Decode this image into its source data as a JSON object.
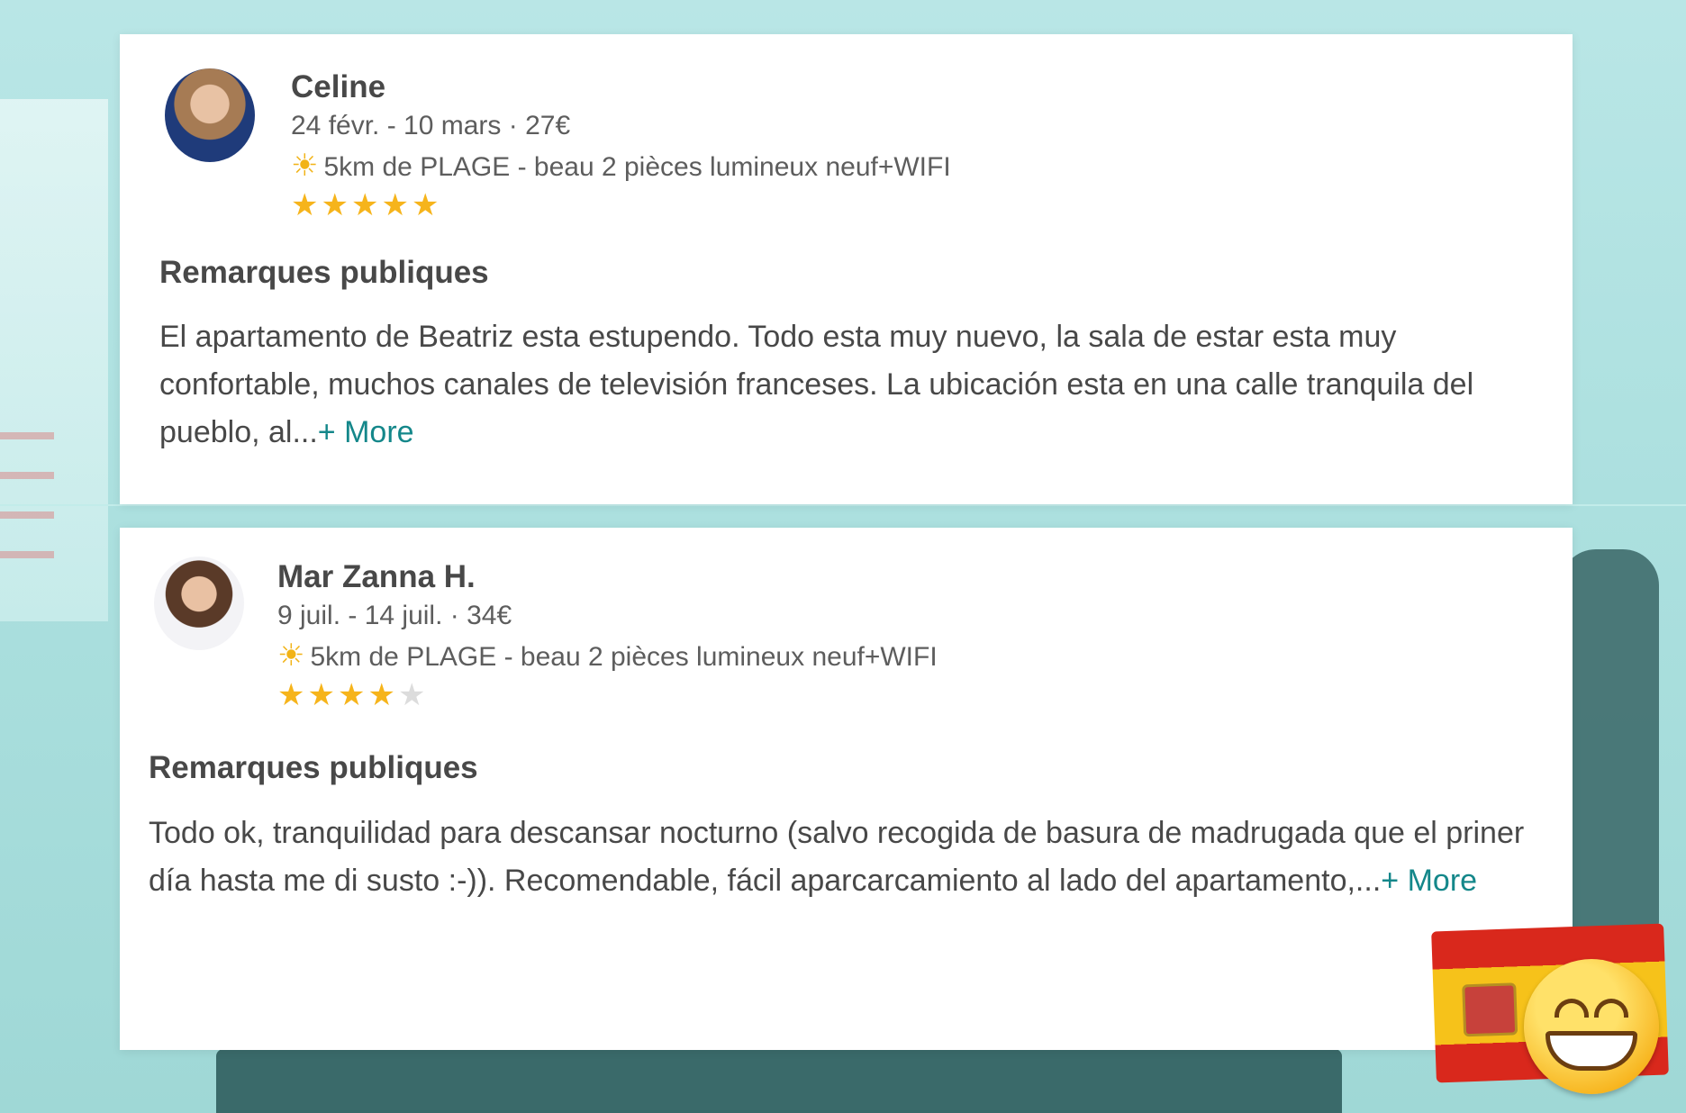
{
  "reviews": [
    {
      "name": "Celine",
      "dates": "24 févr. - 10 mars · 27€",
      "listing": "5km de PLAGE - beau 2 pièces lumineux neuf+WIFI",
      "rating": 5,
      "section_title": "Remarques publiques",
      "text": "El apartamento de Beatriz esta estupendo. Todo esta muy nuevo, la sala de estar esta muy confortable, muchos canales de televisión franceses. La ubicación esta en una calle tranquila del pueblo, al...",
      "more_label": "+ More"
    },
    {
      "name": "Mar Zanna H.",
      "dates": "9 juil. - 14 juil. · 34€",
      "listing": "5km de PLAGE - beau 2 pièces lumineux neuf+WIFI",
      "rating": 4,
      "section_title": "Remarques publiques",
      "text": "Todo ok, tranquilidad para descansar nocturno (salvo recogida de basura de madrugada que el priner día hasta me di susto :-)). Recomendable, fácil aparcarcamiento al lado del apartamento,...",
      "more_label": "+ More"
    }
  ],
  "icons": {
    "listing_icon": "sun-icon",
    "rating_icon": "star-icon",
    "stickers": [
      "spain-flag-icon",
      "grinning-face-icon"
    ]
  },
  "colors": {
    "star_on": "#f6b41b",
    "star_off": "#dcdcdc",
    "more_link": "#14878a",
    "text": "#484848"
  },
  "rating_max": 5
}
